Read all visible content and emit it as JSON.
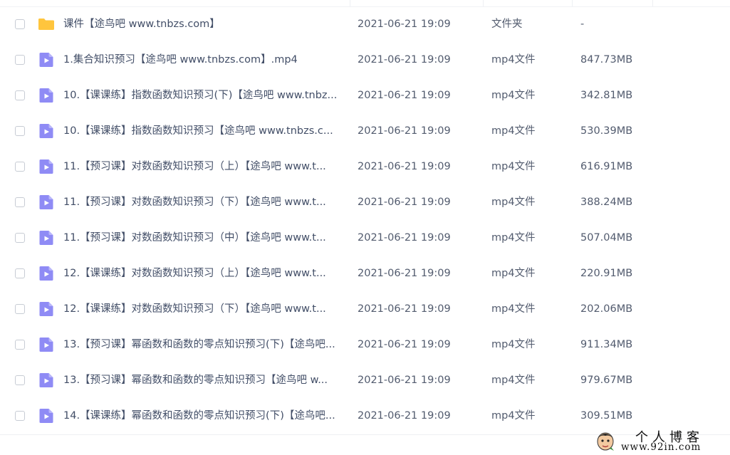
{
  "colors": {
    "folder": "#ffc53d",
    "video": "#8f8bf5",
    "text": "#424e67",
    "secondary_text": "#525b6e"
  },
  "files": [
    {
      "name": "课件【途鸟吧 www.tnbzs.com】",
      "date": "2021-06-21 19:09",
      "type": "文件夹",
      "size": "-",
      "icon": "folder-icon"
    },
    {
      "name": "1.集合知识预习【途鸟吧 www.tnbzs.com】.mp4",
      "date": "2021-06-21 19:09",
      "type": "mp4文件",
      "size": "847.73MB",
      "icon": "video-file-icon"
    },
    {
      "name": "10.【课课练】指数函数知识预习(下)【途鸟吧 www.tnbz...",
      "date": "2021-06-21 19:09",
      "type": "mp4文件",
      "size": "342.81MB",
      "icon": "video-file-icon"
    },
    {
      "name": "10.【课课练】指数函数知识预习【途鸟吧 www.tnbzs.c...",
      "date": "2021-06-21 19:09",
      "type": "mp4文件",
      "size": "530.39MB",
      "icon": "video-file-icon"
    },
    {
      "name": "11.【预习课】对数函数知识预习（上）【途鸟吧 www.t...",
      "date": "2021-06-21 19:09",
      "type": "mp4文件",
      "size": "616.91MB",
      "icon": "video-file-icon"
    },
    {
      "name": "11.【预习课】对数函数知识预习（下）【途鸟吧 www.t...",
      "date": "2021-06-21 19:09",
      "type": "mp4文件",
      "size": "388.24MB",
      "icon": "video-file-icon"
    },
    {
      "name": "11.【预习课】对数函数知识预习（中）【途鸟吧 www.t...",
      "date": "2021-06-21 19:09",
      "type": "mp4文件",
      "size": "507.04MB",
      "icon": "video-file-icon"
    },
    {
      "name": "12.【课课练】对数函数知识预习（上）【途鸟吧 www.t...",
      "date": "2021-06-21 19:09",
      "type": "mp4文件",
      "size": "220.91MB",
      "icon": "video-file-icon"
    },
    {
      "name": "12.【课课练】对数函数知识预习（下）【途鸟吧 www.t...",
      "date": "2021-06-21 19:09",
      "type": "mp4文件",
      "size": "202.06MB",
      "icon": "video-file-icon"
    },
    {
      "name": "13.【预习课】幂函数和函数的零点知识预习(下)【途鸟吧...",
      "date": "2021-06-21 19:09",
      "type": "mp4文件",
      "size": "911.34MB",
      "icon": "video-file-icon"
    },
    {
      "name": "13.【预习课】幂函数和函数的零点知识预习【途鸟吧 w...",
      "date": "2021-06-21 19:09",
      "type": "mp4文件",
      "size": "979.67MB",
      "icon": "video-file-icon"
    },
    {
      "name": "14.【课课练】幂函数和函数的零点知识预习(下)【途鸟吧...",
      "date": "2021-06-21 19:09",
      "type": "mp4文件",
      "size": "309.51MB",
      "icon": "video-file-icon"
    }
  ],
  "watermark": {
    "title": "个人博客",
    "url": "www.92in.com"
  }
}
